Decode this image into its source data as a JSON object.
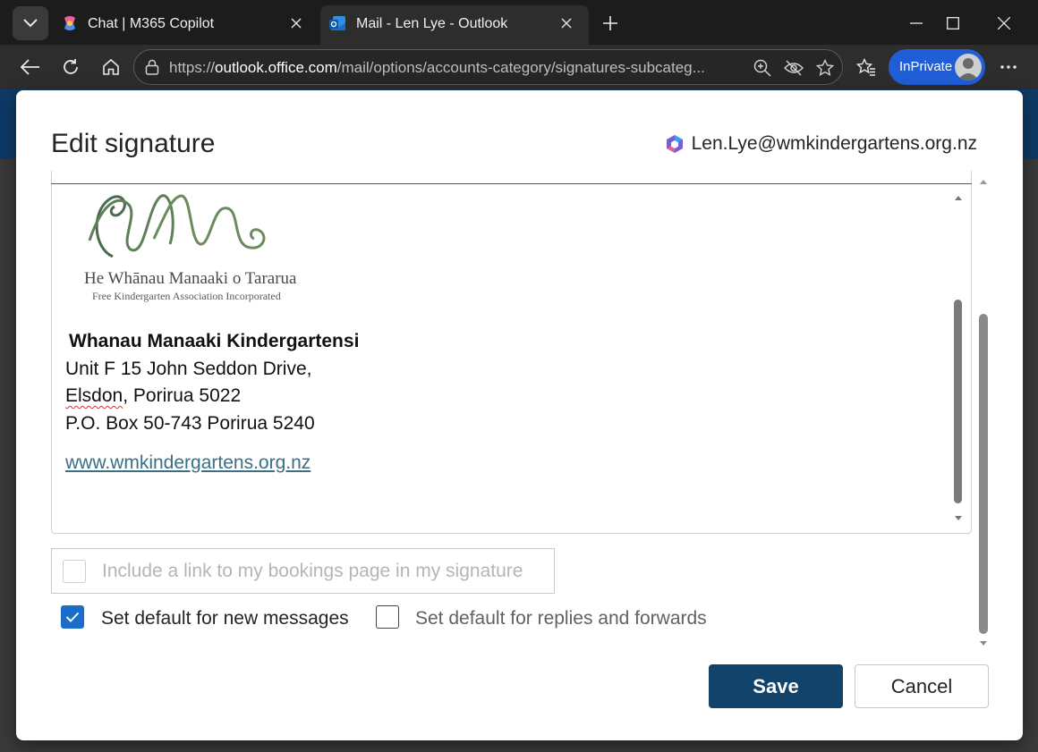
{
  "browser": {
    "tabs": [
      {
        "title": "Chat | M365 Copilot",
        "active": false
      },
      {
        "title": "Mail - Len Lye - Outlook",
        "active": true
      }
    ],
    "url_prefix": "https://",
    "url_host": "outlook.office.com",
    "url_path": "/mail/options/accounts-category/signatures-subcateg...",
    "inprivate_label": "InPrivate"
  },
  "dialog": {
    "title": "Edit signature",
    "account_email": "Len.Lye@wmkindergartens.org.nz",
    "logo": {
      "line1": "He Whānau Manaaki o Tararua",
      "line2": "Free Kindergarten Association Incorporated"
    },
    "signature": {
      "name": "Whanau Manaaki Kindergartensi",
      "address1": "Unit F 15 John Seddon Drive,",
      "address2_spell": "Elsdon",
      "address2_rest": ", Porirua 5022",
      "address3": "P.O. Box 50-743 Porirua 5240",
      "website": "www.wmkindergartens.org.nz"
    },
    "options": {
      "bookings_link": {
        "label": "Include a link to my bookings page in my signature",
        "checked": false,
        "disabled": true
      },
      "default_new": {
        "label": "Set default for new messages",
        "checked": true
      },
      "default_replies": {
        "label": "Set default for replies and forwards",
        "checked": false
      }
    },
    "buttons": {
      "save": "Save",
      "cancel": "Cancel"
    }
  },
  "colors": {
    "save_button": "#12436b",
    "checkbox_checked": "#1a6ec9",
    "inprivate": "#1f5ed6",
    "link": "#3a6f86"
  }
}
